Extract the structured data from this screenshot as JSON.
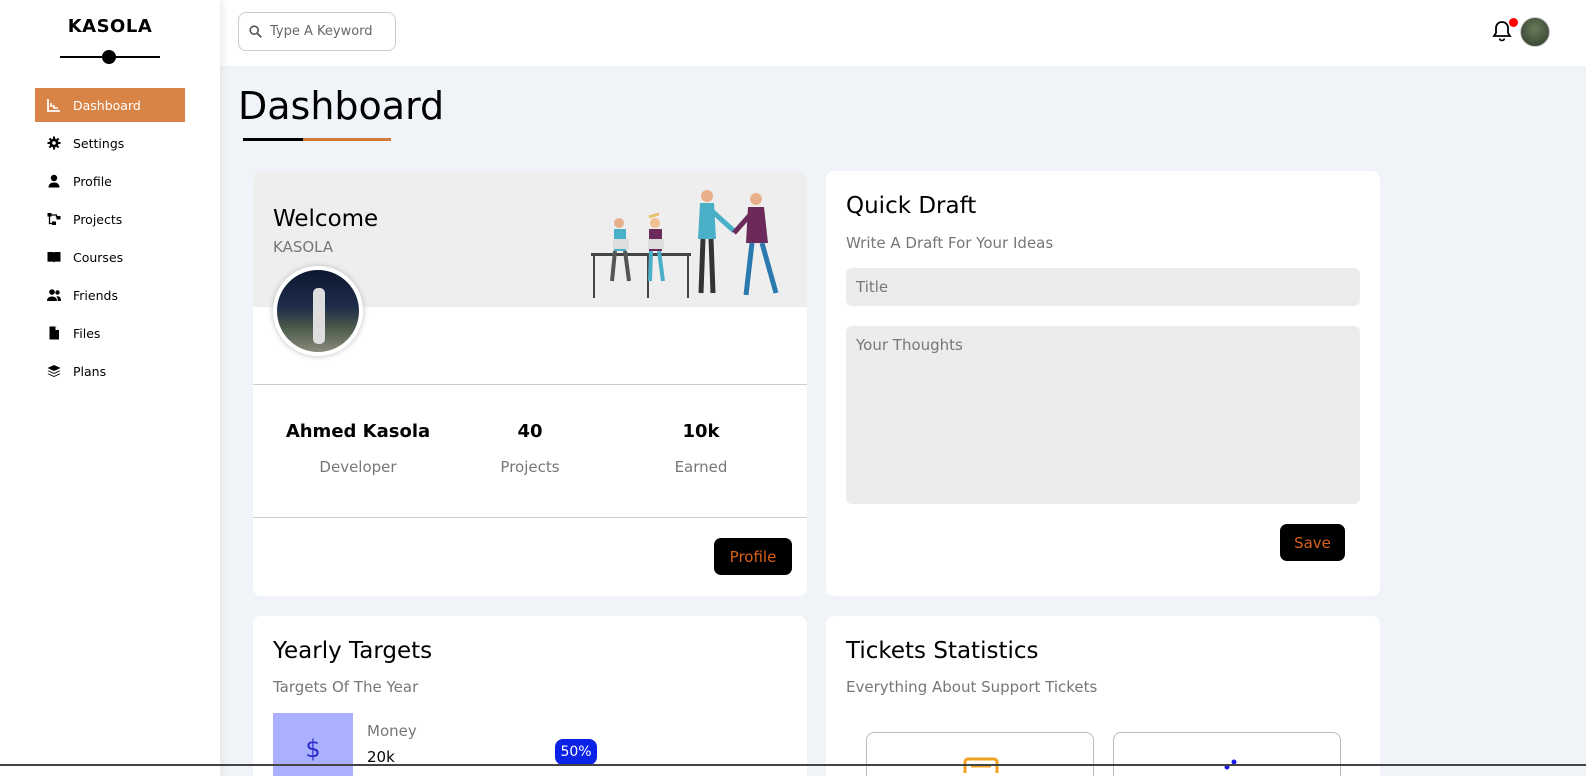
{
  "brand": {
    "name": "KASOLA"
  },
  "sidebar": {
    "items": [
      {
        "label": "Dashboard",
        "icon": "chart-icon",
        "active": true
      },
      {
        "label": "Settings",
        "icon": "gear-icon"
      },
      {
        "label": "Profile",
        "icon": "user-icon"
      },
      {
        "label": "Projects",
        "icon": "diagram-icon"
      },
      {
        "label": "Courses",
        "icon": "book-icon"
      },
      {
        "label": "Friends",
        "icon": "users-icon"
      },
      {
        "label": "Files",
        "icon": "file-icon"
      },
      {
        "label": "Plans",
        "icon": "layers-icon"
      }
    ]
  },
  "header": {
    "search_placeholder": "Type A Keyword",
    "notification_icon": "bell-icon",
    "accent": "#d98447"
  },
  "page": {
    "title": "Dashboard"
  },
  "welcome": {
    "title": "Welcome",
    "subtitle": "KASOLA",
    "stats": [
      {
        "value": "Ahmed Kasola",
        "label": "Developer"
      },
      {
        "value": "40",
        "label": "Projects"
      },
      {
        "value": "10k",
        "label": "Earned"
      }
    ],
    "button": "Profile"
  },
  "draft": {
    "title": "Quick Draft",
    "subtitle": "Write A Draft For Your Ideas",
    "title_placeholder": "Title",
    "body_placeholder": "Your Thoughts",
    "button": "Save"
  },
  "targets": {
    "title": "Yearly Targets",
    "subtitle": "Targets Of The Year",
    "money_symbol": "$",
    "money_label": "Money",
    "money_value": "20k",
    "progress_percent": "50%"
  },
  "tickets": {
    "title": "Tickets Statistics",
    "subtitle": "Everything About Support Tickets"
  }
}
